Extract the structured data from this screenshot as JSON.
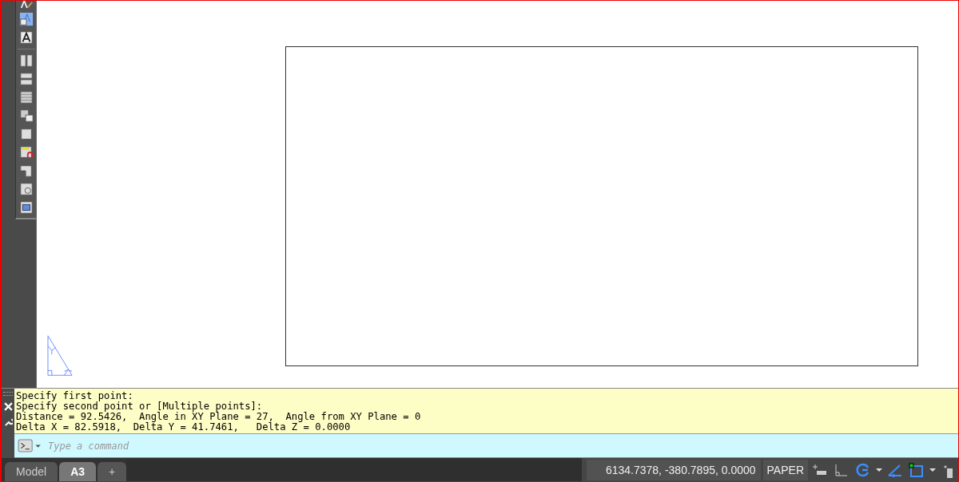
{
  "command_history": [
    "Specify first point:",
    "Specify second point or [Multiple points]:",
    "Distance = 92.5426,  Angle in XY Plane = 27,  Angle from XY Plane = 0",
    "Delta X = 82.5918,  Delta Y = 41.7461,   Delta Z = 0.0000"
  ],
  "command_line": {
    "placeholder": "Type a command"
  },
  "layout_tabs": [
    {
      "label": "Model",
      "selected": false
    },
    {
      "label": "A3",
      "selected": true
    },
    {
      "label": "+",
      "selected": false
    }
  ],
  "status_bar": {
    "coordinates": "6134.7378, -380.7895, 0.0000",
    "space": "PAPER"
  }
}
